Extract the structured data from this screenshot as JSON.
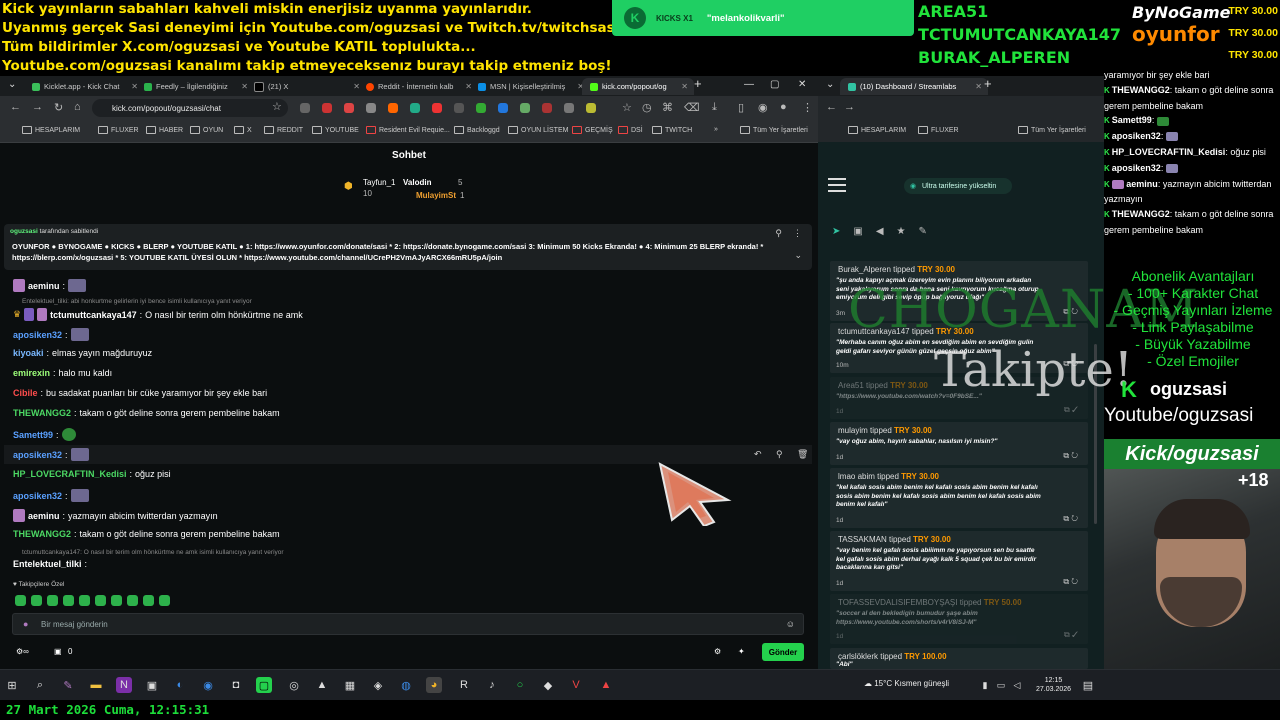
{
  "overlay": {
    "marquee": [
      "Kick yayınların sabahları kahveli miskin enerjisiz uyanma yayınlarıdır.",
      "Uyanmış gerçek Sasi deneyimi için Youtube.com/oguzsasi ve Twitch.tv/twitchsasi",
      "Tüm bildirimler X.com/oguzsasi ve Youtube KATIL toplulukta...",
      "Youtube.com/oguzsasi kanalımı takip etmeyeceksenız burayı takip etmeniz boş!"
    ],
    "kick_banner": {
      "count": "KICKS X1",
      "message": "\"melankolikvarli\""
    },
    "sub_names": [
      "AREA51",
      "TCTUMUTCANKAYA147",
      "BURAK_ALPEREN"
    ],
    "logo_top": "ByNoGame",
    "logo_bottom": "oyunfor",
    "top_tips": [
      "TRY 30.00",
      "TRY 30.00",
      "TRY 30.00"
    ],
    "choganam": "CHOGANAM",
    "takipte": "Takipte!",
    "kick_handle": "oguzsasi",
    "youtube_handle": "Youtube/oguzsasi",
    "kick_bar": "Kick/oguzsasi",
    "plus_count": "+18",
    "benefits": [
      "Abonelik Avantajları",
      "- 100+ Karakter Chat",
      "- Geçmiş Yayınları İzleme",
      "- Link Paylaşabilme",
      "- Büyük Yazabilme",
      "- Özel Emojiler"
    ],
    "date_line": "27 Mart 2026 Cuma, 12:15:31"
  },
  "right_chat": [
    {
      "user": "",
      "text": "yaramıyor bir şey ekle bari",
      "badge": false
    },
    {
      "user": "THEWANGG2",
      "text": ": takam o göt deline sonra gerem pembeline bakam",
      "badge": true
    },
    {
      "user": "Samett99",
      "text": ": ",
      "badge": true
    },
    {
      "user": "aposiken32",
      "text": ": ",
      "badge": true
    },
    {
      "user": "HP_LOVECRAFTIN_Kedisi",
      "text": ": oğuz pisi",
      "badge": true
    },
    {
      "user": "aposiken32",
      "text": ": ",
      "badge": true
    },
    {
      "user": "aeminu",
      "text": ": yazmayın abicim twitterdan yazmayın",
      "badge": true
    },
    {
      "user": "THEWANGG2",
      "text": ": takam o göt deline sonra gerem pembeline bakam",
      "badge": true
    }
  ],
  "browser": {
    "tabs": [
      "Kicklet.app - Kick Chat",
      "Feedly – İlgilendiğiniz",
      "(21) X",
      "Reddit - İnternetin kalb",
      "MSN | Kişiselleştirilmiş",
      "kick.com/popout/og"
    ],
    "url": "kick.com/popout/oguzsasi/chat",
    "bookmarks": [
      "HESAPLARIM",
      "FLUXER",
      "HABER",
      "OYUN",
      "X",
      "REDDIT",
      "YOUTUBE",
      "Resident Evil Requie...",
      "Backloggd",
      "OYUN LİSTEM",
      "GEÇMİŞ",
      "DSİ",
      "TWITCH"
    ],
    "all_bookmarks": "Tüm Yer İşaretleri"
  },
  "chat": {
    "title": "Sohbet",
    "leaders": [
      {
        "name": "Tayfun_1",
        "value": "10"
      },
      {
        "name": "Valodin",
        "value": "5"
      },
      {
        "name": "MulayimSt",
        "value": "1"
      }
    ],
    "pinned_by": "oguzsasi",
    "pinned_suffix": "tarafından sabitlendi",
    "pinned_text": "OYUNFOR ● BYNOGAME ● KICKS ● BLERP ● YOUTUBE KATIL ● 1: https://www.oyunfor.com/donate/sasi * 2: https://donate.bynogame.com/sasi 3: Minimum 50 Kicks Ekranda! ● 4: Minimum 25 BLERP ekranda! * https://blerp.com/x/oguzsasi * 5: YOUTUBE KATIL ÜYESİ OLUN * https://www.youtube.com/channel/UCrePH2VmAJyARCX66mRU5pA/join",
    "messages": [
      {
        "user": "aeminu",
        "color": "#ffffff",
        "text": ""
      },
      {
        "user": "",
        "color": "",
        "text": "Entelektuel_tilki: abi honkurtme gelirlerin iyi bence isimli kullanıcıya yanıt veriyor",
        "reply": true
      },
      {
        "user": "tctumuttcankaya147",
        "color": "#ffffff",
        "text": "O nasıl bir terim olm hönkürtme ne amk"
      },
      {
        "user": "aposiken32",
        "color": "#5aa0ff",
        "text": ""
      },
      {
        "user": "kiyoaki",
        "color": "#7ab8ff",
        "text": "elmas yayın mağduruyuz"
      },
      {
        "user": "emirexin",
        "color": "#9dff7a",
        "text": "halo mu kaldı"
      },
      {
        "user": "Cibile",
        "color": "#ff4d4d",
        "text": "bu sadakat puanları bir cüke yaramıyor bir şey ekle bari"
      },
      {
        "user": "THEWANGG2",
        "color": "#4cd964",
        "text": "takam o göt deline sonra gerem pembeline bakam"
      },
      {
        "user": "Samett99",
        "color": "#5aa0ff",
        "text": ""
      },
      {
        "user": "aposiken32",
        "color": "#5aa0ff",
        "text": ""
      },
      {
        "user": "HP_LOVECRAFTIN_Kedisi",
        "color": "#4cd964",
        "text": "oğuz pisi"
      },
      {
        "user": "aposiken32",
        "color": "#5aa0ff",
        "text": ""
      },
      {
        "user": "aeminu",
        "color": "#ffffff",
        "text": "yazmayın abicim twitterdan yazmayın"
      },
      {
        "user": "THEWANGG2",
        "color": "#4cd964",
        "text": "takam o göt deline sonra gerem pembeline bakam"
      },
      {
        "user": "",
        "color": "",
        "text": "tctumuttcankaya147: O nasıl bir terim olm hönkürtme ne amk isimli kullanıcıya yanıt veriyor",
        "reply": true
      },
      {
        "user": "Entelektuel_tilki",
        "color": "#ffffff",
        "text": ""
      }
    ],
    "followers_only": "Takipçilere Özel",
    "input_placeholder": "Bir mesaj gönderin",
    "send_label": "Gönder",
    "bottom_count": "0"
  },
  "streamlabs": {
    "tab": "(10) Dashboard / Streamlabs",
    "promo": "Ultra tarifesine yükseltin",
    "bookmarks": [
      "HESAPLARIM",
      "FLUXER"
    ],
    "all_bookmarks": "Tüm Yer İşaretleri",
    "tips": [
      {
        "user": "Burak_Alperen",
        "amount": "TRY 30.00",
        "msg": "\"şu anda kapıyı açmak üzereyim evin planını biliyorum arkadan seni yakalıyorum sonra da bana seni kavrıyorum kucağına oturup emiyorum deli gibi sevip öpüp bağlıyoruz ufağı\"",
        "time": "3m",
        "dim": false
      },
      {
        "user": "tctumuttcankaya147",
        "amount": "TRY 30.00",
        "msg": "\"Merhaba canım oğuz abim en sevdiğim abim en sevdiğim gulin geldi gafarı seviyor günün güzel geçsin oğuz abim\"",
        "time": "10m",
        "dim": false
      },
      {
        "user": "Area51",
        "amount": "TRY 30.00",
        "msg": "\"https://www.youtube.com/watch?v=0F9bSE...\"",
        "time": "1d",
        "dim": true
      },
      {
        "user": "mulayim",
        "amount": "TRY 30.00",
        "msg": "\"vay oğuz abim, hayırlı sabahlar, nasılsın iyi misin?\"",
        "time": "1d",
        "dim": false
      },
      {
        "user": "lmao abim",
        "amount": "TRY 30.00",
        "msg": "\"kel kafalı sosis abim benim kel kafalı sosis abim benim kel kafalı sosis abim benim kel kafalı sosis abim benim kel kafalı sosis abim benim kel kafalı\"",
        "time": "1d",
        "dim": false
      },
      {
        "user": "TASSAKMAN",
        "amount": "TRY 30.00",
        "msg": "\"vay benim kel gafalı sosis abiiimm ne yapıyorsun sen bu saatte kel gafalı sosis abim derhal ayağı kalk 5 squad çek bu bir emirdir bacaklarına kan gitsi\"",
        "time": "1d",
        "dim": false
      },
      {
        "user": "TOFASSEVDALISIFEMBOYŞAŞI",
        "amount": "TRY 50.00",
        "msg": "\"soccer al den bekledigin bumudur şaşe abim https://www.youtube.com/shorts/v4rV8iSJ-M\"",
        "time": "1d",
        "dim": true
      },
      {
        "user": "çarlslöklerk",
        "amount": "TRY 100.00",
        "msg": "\"Abi\"",
        "time": "",
        "dim": false
      }
    ]
  },
  "taskbar": {
    "weather": "15°C  Kısmen güneşli",
    "time": "12:15",
    "date": "27.03.2026"
  }
}
